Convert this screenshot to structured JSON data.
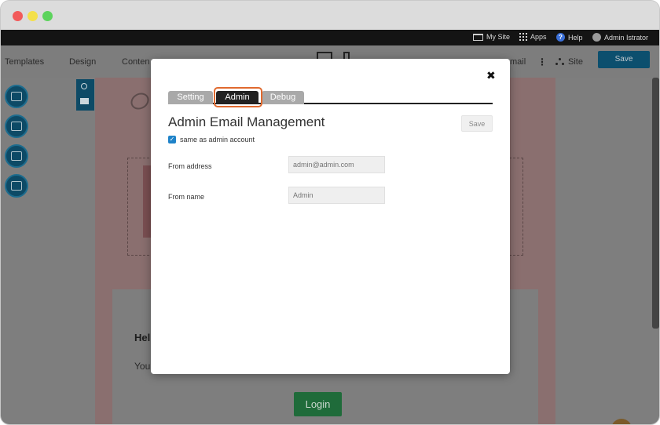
{
  "topbar": {
    "my_site": "My Site",
    "apps": "Apps",
    "help": "Help",
    "user": "Admin Istrator"
  },
  "toolbar": {
    "templates": "Templates",
    "design": "Design",
    "content": "Conten",
    "email": "mail",
    "site": "Site",
    "save": "Save"
  },
  "page": {
    "greeting": "Hel",
    "body_fragment": "You",
    "login": "Login"
  },
  "modal": {
    "tabs": [
      {
        "label": "Setting",
        "active": false
      },
      {
        "label": "Admin",
        "active": true
      },
      {
        "label": "Debug",
        "active": false
      }
    ],
    "title": "Admin Email Management",
    "save": "Save",
    "same_as_admin_label": "same as admin account",
    "same_as_admin_checked": true,
    "fields": {
      "from_address_label": "From address",
      "from_address_placeholder": "admin@admin.com",
      "from_name_label": "From name",
      "from_name_placeholder": "Admin"
    }
  },
  "colors": {
    "accent": "#1f83c9",
    "highlight": "#e0692e",
    "active_tab": "#222222"
  }
}
